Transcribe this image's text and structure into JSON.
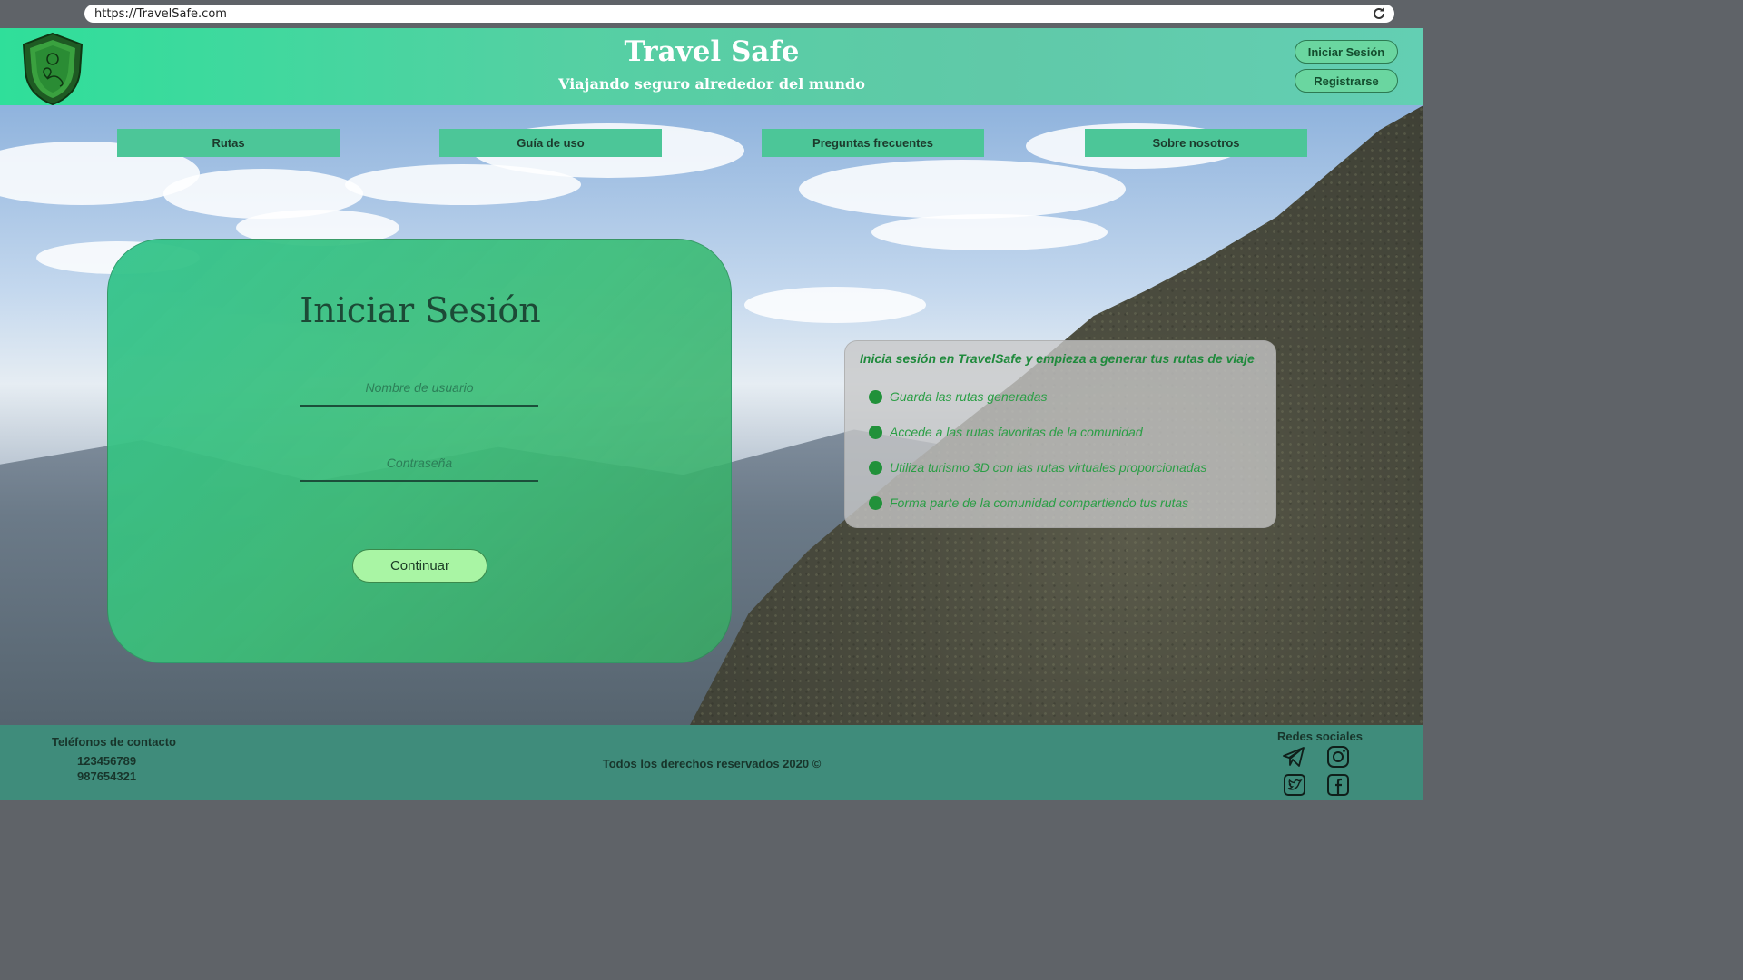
{
  "browser": {
    "url": "https://TravelSafe.com"
  },
  "header": {
    "title": "Travel Safe",
    "subtitle": "Viajando seguro alrededor del mundo",
    "login_label": "Iniciar Sesión",
    "register_label": "Registrarse"
  },
  "nav": [
    {
      "label": "Rutas"
    },
    {
      "label": "Guía de uso"
    },
    {
      "label": "Preguntas frecuentes"
    },
    {
      "label": "Sobre nosotros"
    }
  ],
  "login": {
    "title": "Iniciar Sesión",
    "username_placeholder": "Nombre de usuario",
    "username_value": "",
    "password_placeholder": "Contraseña",
    "password_value": "",
    "continue_label": "Continuar"
  },
  "info": {
    "heading": "Inicia sesión en TravelSafe y empieza a generar tus rutas de viaje",
    "items": [
      {
        "text": "Guarda las rutas generadas"
      },
      {
        "text": "Accede a las rutas favoritas de la comunidad"
      },
      {
        "text": "Utiliza turismo 3D con las rutas virtuales proporcionadas"
      },
      {
        "text": "Forma parte de la comunidad compartiendo tus rutas"
      }
    ]
  },
  "footer": {
    "phones_title": "Teléfonos de contacto",
    "phones": [
      "123456789",
      "987654321"
    ],
    "rights": "Todos los derechos reservados 2020 ©",
    "social_title": "Redes sociales",
    "social_icons": [
      "telegram-icon",
      "instagram-icon",
      "twitter-icon",
      "facebook-icon"
    ]
  },
  "colors": {
    "brand_green": "#4cc698",
    "header_gradient_start": "#2fdf9a",
    "footer": "#3f8c7b",
    "button_light_green": "#a9f5a4",
    "info_text_green": "#2a9e45"
  }
}
